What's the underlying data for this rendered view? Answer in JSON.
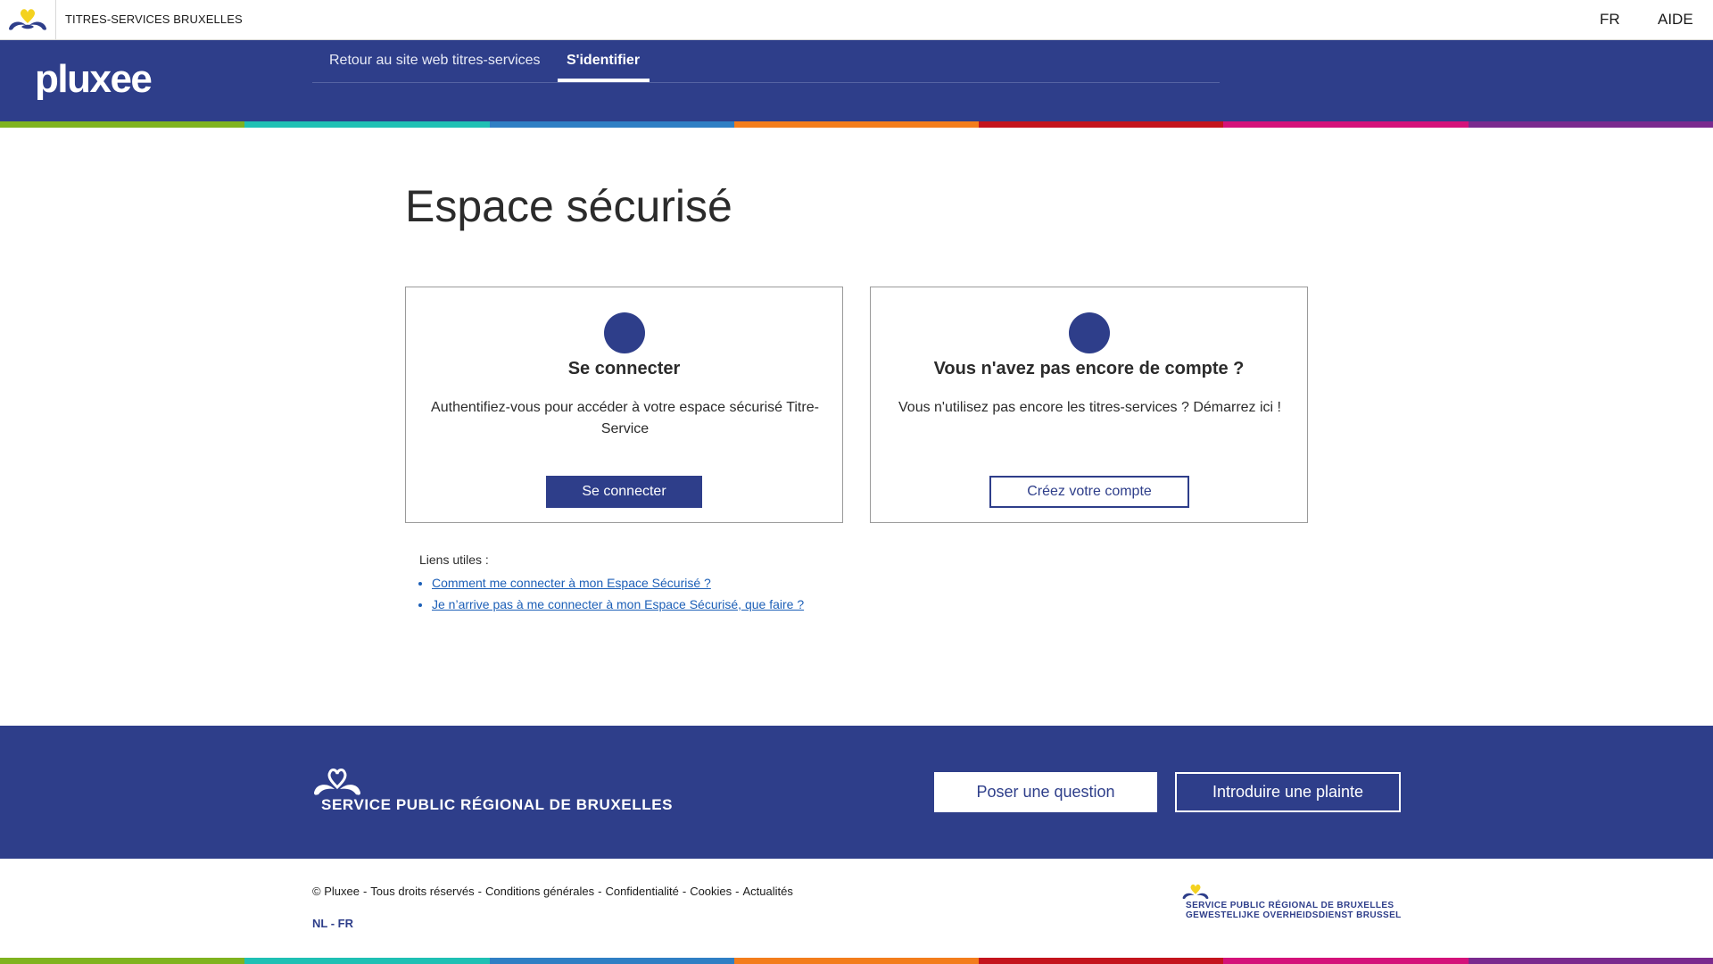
{
  "topbar": {
    "site_title": "TITRES-SERVICES BRUXELLES",
    "language": "FR",
    "help": "AIDE"
  },
  "header": {
    "logo": "pluxee",
    "nav": {
      "back_label": "Retour au site web titres-services",
      "login_label": "S'identifier"
    }
  },
  "stripe_colors": [
    "#7fb31f",
    "#1fc0b4",
    "#2f7fc4",
    "#f37d1c",
    "#c4141d",
    "#d4127a",
    "#7a2a8e"
  ],
  "main": {
    "title": "Espace sécurisé",
    "login_card": {
      "title": "Se connecter",
      "text": "Authentifiez-vous pour accéder à votre espace sécurisé Titre-Service",
      "button": "Se connecter"
    },
    "register_card": {
      "title": "Vous n'avez pas encore de compte ?",
      "text": "Vous n'utilisez pas encore les titres-services ? Démarrez ici !",
      "button": "Créez votre compte"
    },
    "links": {
      "label": "Liens utiles :",
      "items": [
        "Comment me connecter à mon Espace Sécurisé ?",
        "Je n’arrive pas à me connecter à mon Espace Sécurisé, que faire ?"
      ]
    }
  },
  "footer": {
    "org_name": "SERVICE PUBLIC RÉGIONAL DE BRUXELLES",
    "question_button": "Poser une question",
    "complaint_button": "Introduire une plainte",
    "legal": {
      "copyright": "© Pluxee",
      "rights": "Tous droits réservés",
      "terms": "Conditions générales",
      "privacy": "Confidentialité",
      "cookies": "Cookies",
      "news": "Actualités"
    },
    "lang_nl": "NL",
    "lang_fr": "FR",
    "logo_line1": "SERVICE PUBLIC RÉGIONAL DE BRUXELLES",
    "logo_line2": "GEWESTELIJKE OVERHEIDSDIENST BRUSSEL"
  },
  "colors": {
    "brand_blue": "#2e3e8a",
    "link_blue": "#1c5fb7",
    "heart_yellow": "#f4d21f"
  }
}
